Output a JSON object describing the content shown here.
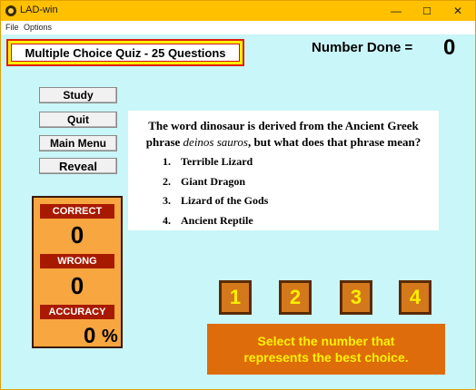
{
  "window": {
    "title": "LAD-win"
  },
  "menu": {
    "file": "File",
    "options": "Options"
  },
  "controls": {
    "minimize": "—",
    "maximize": "☐",
    "close": "✕"
  },
  "quiz": {
    "title": "Multiple Choice Quiz - 25 Questions"
  },
  "progress": {
    "label": "Number Done =",
    "value": "0"
  },
  "buttons": {
    "study": "Study",
    "quit": "Quit",
    "main_menu": "Main Menu",
    "reveal": "Reveal"
  },
  "score": {
    "correct_label": "CORRECT",
    "correct_value": "0",
    "wrong_label": "WRONG",
    "wrong_value": "0",
    "accuracy_label": "ACCURACY",
    "accuracy_value": "0",
    "accuracy_unit": "%"
  },
  "question": {
    "line1": "The word dinosaur is derived from the Ancient Greek",
    "line2_pre": "phrase ",
    "line2_em": "deinos sauros",
    "line2_post": ", but what does that phrase mean?",
    "options": [
      {
        "num": "1.",
        "text": "Terrible Lizard"
      },
      {
        "num": "2.",
        "text": "Giant Dragon"
      },
      {
        "num": "3.",
        "text": "Lizard of the Gods"
      },
      {
        "num": "4.",
        "text": "Ancient Reptile"
      }
    ]
  },
  "answer_buttons": [
    "1",
    "2",
    "3",
    "4"
  ],
  "instruction": {
    "line1": "Select the number that",
    "line2": "represents the best choice."
  }
}
